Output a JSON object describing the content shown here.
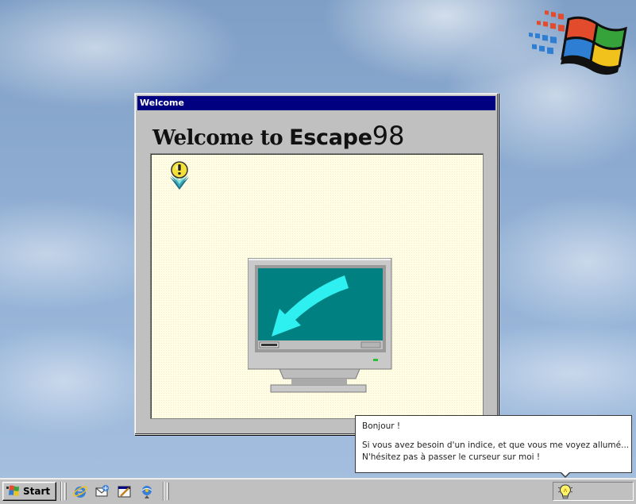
{
  "desktop": {
    "logo_icon": "windows-98-flag-logo"
  },
  "welcome_window": {
    "title": "Welcome",
    "heading_part1": "Welcome to",
    "heading_part2": "Escape",
    "heading_part3": "98",
    "hint_icon": "exclamation-hint-icon",
    "illustration": "monitor-with-arrow-to-start-icon",
    "colors": {
      "titlebar": "#000080",
      "content_bg": "#fffde6",
      "screen": "#008080",
      "arrow": "#00ffff"
    }
  },
  "tooltip": {
    "line1": "Bonjour !",
    "line2": "Si vous avez besoin d'un indice, et que vous me voyez allumé...",
    "line3": "N'hésitez pas à passer le curseur sur moi !"
  },
  "taskbar": {
    "start_label": "Start",
    "quick_launch": [
      {
        "name": "internet-explorer-icon"
      },
      {
        "name": "outlook-express-icon"
      },
      {
        "name": "show-desktop-icon"
      },
      {
        "name": "channels-icon"
      }
    ],
    "tray_icon": "lightbulb-icon"
  }
}
